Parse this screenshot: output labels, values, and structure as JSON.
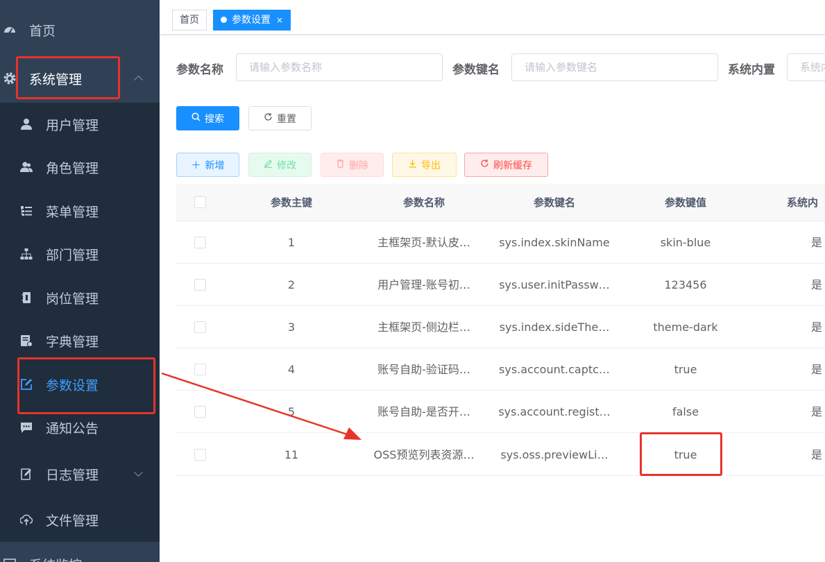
{
  "sidebar": {
    "items": [
      {
        "label": "首页",
        "icon": "dashboard-icon"
      },
      {
        "label": "系统管理",
        "icon": "gear-icon"
      },
      {
        "label": "用户管理",
        "icon": "user-icon"
      },
      {
        "label": "角色管理",
        "icon": "users-icon"
      },
      {
        "label": "菜单管理",
        "icon": "tree-table-icon"
      },
      {
        "label": "部门管理",
        "icon": "org-tree-icon"
      },
      {
        "label": "岗位管理",
        "icon": "post-icon"
      },
      {
        "label": "字典管理",
        "icon": "dict-icon"
      },
      {
        "label": "参数设置",
        "icon": "edit-icon"
      },
      {
        "label": "通知公告",
        "icon": "message-icon"
      },
      {
        "label": "日志管理",
        "icon": "log-icon"
      },
      {
        "label": "文件管理",
        "icon": "upload-icon"
      },
      {
        "label": "系统监控",
        "icon": "monitor-icon"
      }
    ],
    "active_color": "#409eff",
    "bg_color": "#304156"
  },
  "tags": {
    "home": "首页",
    "current": "参数设置",
    "close_symbol": "×"
  },
  "search_form": {
    "param_name_label": "参数名称",
    "param_name_placeholder": "请输入参数名称",
    "param_key_label": "参数键名",
    "param_key_placeholder": "请输入参数键名",
    "builtin_label": "系统内置",
    "builtin_placeholder": "系统内",
    "search_button": "搜索",
    "reset_button": "重置"
  },
  "toolbar": {
    "add": "新增",
    "edit": "修改",
    "delete": "删除",
    "export": "导出",
    "refresh_cache": "刷新缓存"
  },
  "table": {
    "columns": [
      "参数主键",
      "参数名称",
      "参数键名",
      "参数键值",
      "系统内"
    ],
    "rows": [
      {
        "id": "1",
        "name": "主框架页-默认皮…",
        "key": "sys.index.skinName",
        "value": "skin-blue",
        "builtin": "是"
      },
      {
        "id": "2",
        "name": "用户管理-账号初…",
        "key": "sys.user.initPassw…",
        "value": "123456",
        "builtin": "是"
      },
      {
        "id": "3",
        "name": "主框架页-侧边栏…",
        "key": "sys.index.sideThe…",
        "value": "theme-dark",
        "builtin": "是"
      },
      {
        "id": "4",
        "name": "账号自助-验证码…",
        "key": "sys.account.captc…",
        "value": "true",
        "builtin": "是"
      },
      {
        "id": "5",
        "name": "账号自助-是否开…",
        "key": "sys.account.regist…",
        "value": "false",
        "builtin": "是"
      },
      {
        "id": "11",
        "name": "OSS预览列表资源…",
        "key": "sys.oss.previewLi…",
        "value": "true",
        "builtin": "是"
      }
    ]
  },
  "annotation_color": "#e8332a"
}
